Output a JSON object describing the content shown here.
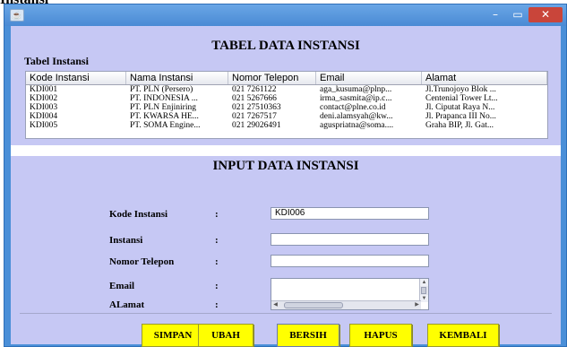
{
  "page_caption": "Instansi",
  "window": {
    "icon": "java-app-icon",
    "controls": {
      "minimize": "–",
      "maximize": "▭",
      "close": "✕"
    }
  },
  "table_section": {
    "title": "TABEL DATA INSTANSI",
    "border_label": "Tabel Instansi",
    "columns": [
      "Kode Instansi",
      "Nama Instansi",
      "Nomor Telepon",
      "Email",
      "Alamat"
    ],
    "rows": [
      [
        "KDI001",
        "PT. PLN (Persero)",
        "021 7261122",
        "aga_kusuma@plnp...",
        "Jl.Trunojoyo Blok ..."
      ],
      [
        "KDI002",
        "PT. INDONESIA ...",
        "021 5267666",
        "irma_sasmita@ip.c...",
        "Centenial Tower Lt..."
      ],
      [
        "KDI003",
        "PT. PLN Enjiniring",
        "021 27510363",
        "contact@plne.co.id",
        "Jl. Ciputat Raya N..."
      ],
      [
        "KDI004",
        "PT. KWARSA HE...",
        "021 7267517",
        "deni.alamsyah@kw...",
        "Jl. Prapanca III No..."
      ],
      [
        "KDI005",
        "PT. SOMA Engine...",
        "021 29026491",
        "aguspriatna@soma....",
        "Graha BIP, Jl. Gat..."
      ]
    ]
  },
  "form_section": {
    "title": "INPUT DATA INSTANSI",
    "colon": ":",
    "fields": {
      "kode": {
        "label": "Kode Instansi",
        "value": "KDI006"
      },
      "instansi": {
        "label": "Instansi",
        "value": ""
      },
      "telepon": {
        "label": "Nomor Telepon",
        "value": ""
      },
      "email": {
        "label": "Email",
        "value": ""
      },
      "alamat": {
        "label": "ALamat",
        "value": ""
      }
    },
    "scroll_glyphs": {
      "up": "▲",
      "down": "▼",
      "left": "◀",
      "right": "▶"
    }
  },
  "buttons": {
    "simpan": "SIMPAN",
    "ubah": "UBAH",
    "bersih": "BERSIH",
    "hapus": "HAPUS",
    "kembali": "KEMBALI"
  },
  "colors": {
    "window_frame": "#4a8fd8",
    "panel_bg": "#c6c8f4",
    "button_bg": "#ffff00",
    "close_button": "#c9453a"
  }
}
